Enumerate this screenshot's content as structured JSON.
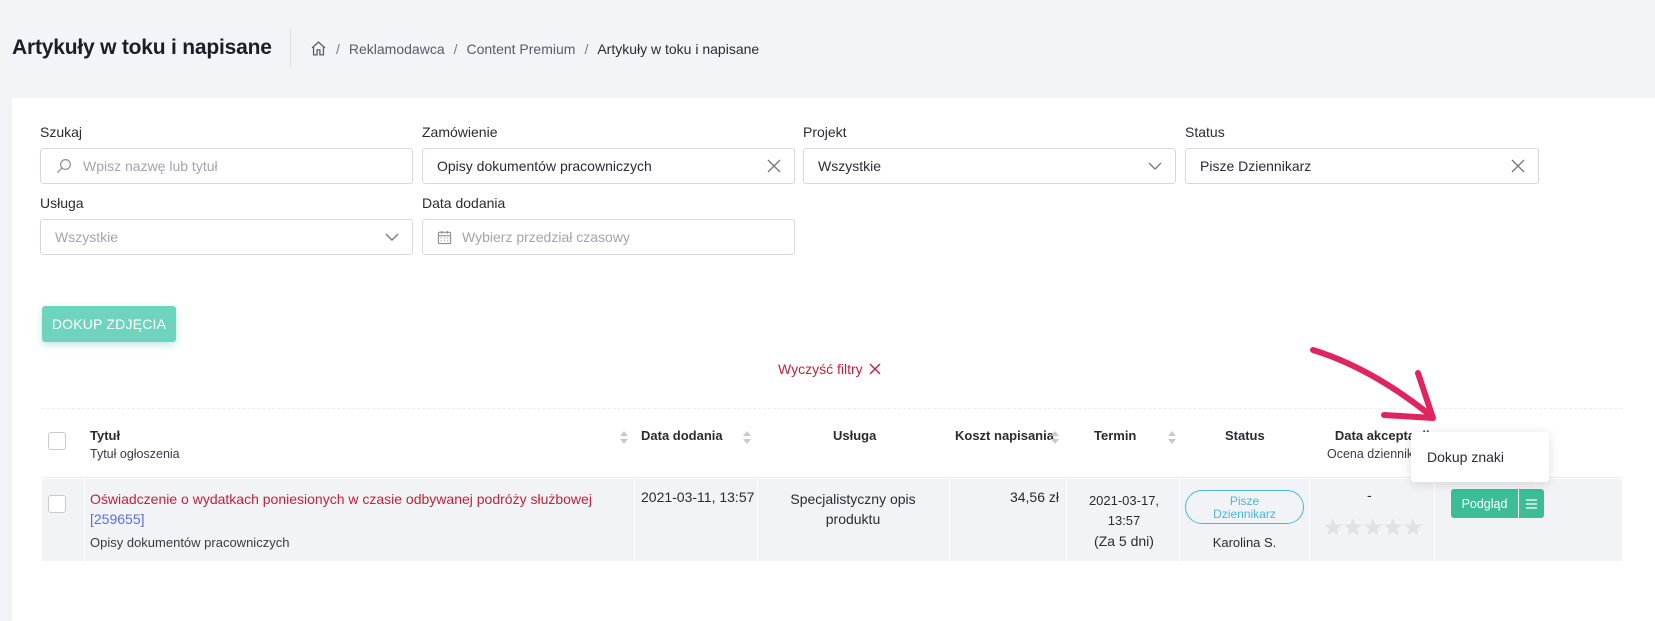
{
  "header": {
    "title": "Artykuły w toku i napisane",
    "breadcrumb": [
      "Reklamodawca",
      "Content Premium",
      "Artykuły w toku i napisane"
    ],
    "separator": "/"
  },
  "filters": {
    "search": {
      "label": "Szukaj",
      "placeholder": "Wpisz nazwę lub tytuł"
    },
    "order": {
      "label": "Zamówienie",
      "value": "Opisy dokumentów pracowniczych"
    },
    "project": {
      "label": "Projekt",
      "value": "Wszystkie"
    },
    "status": {
      "label": "Status",
      "value": "Pisze Dziennikarz"
    },
    "service": {
      "label": "Usługa",
      "value": "Wszystkie"
    },
    "date_added": {
      "label": "Data dodania",
      "placeholder": "Wybierz przedział czasowy"
    }
  },
  "actions": {
    "photo_button": "DOKUP ZDJĘCIA",
    "clear_filters": "Wyczyść filtry"
  },
  "table": {
    "columns": {
      "title": "Tytuł",
      "title_sub": "Tytuł ogłoszenia",
      "date_added": "Data dodania",
      "service": "Usługa",
      "cost": "Koszt napisania",
      "deadline": "Termin",
      "status": "Status",
      "accept_date": "Data akceptacji",
      "rating": "Ocena dziennikarza"
    },
    "rows": [
      {
        "title": "Oświadczenie o wydatkach poniesionych w czasie odbywanej podróży służbowej",
        "id": "[259655]",
        "order": "Opisy dokumentów pracowniczych",
        "date_added": "2021-03-11, 13:57",
        "service_line1": "Specjalistyczny opis",
        "service_line2": "produktu",
        "cost": "34,56 zł",
        "deadline_date": "2021-03-17,",
        "deadline_time": "13:57",
        "deadline_rel": "(Za 5 dni)",
        "status_line1": "Pisze",
        "status_line2": "Dziennikarz",
        "journalist": "Karolina S.",
        "accept_date": "-",
        "rating_stars": 0,
        "preview_button": "Podgląd"
      }
    ]
  },
  "dropdown_menu": {
    "item": "Dokup znaki"
  },
  "colors": {
    "accent_green": "#3cbd96",
    "link_red": "#c0233b",
    "status_blue": "#49b9d4",
    "annotation": "#e0245e"
  }
}
